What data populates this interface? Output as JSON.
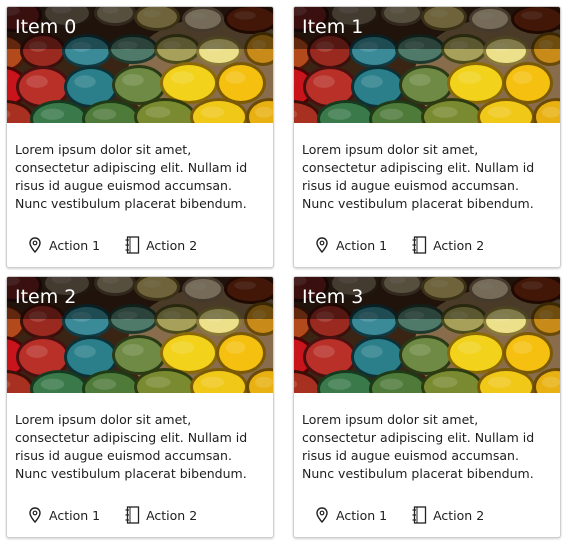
{
  "cards": [
    {
      "title": "Item 0",
      "body": "Lorem ipsum dolor sit amet, consectetur adipiscing elit. Nullam id risus id augue euismod accumsan. Nunc vestibulum placerat bibendum.",
      "actions": [
        {
          "label": "Action 1",
          "icon": "map-pin-icon"
        },
        {
          "label": "Action 2",
          "icon": "notebook-icon"
        }
      ]
    },
    {
      "title": "Item 1",
      "body": "Lorem ipsum dolor sit amet, consectetur adipiscing elit. Nullam id risus id augue euismod accumsan. Nunc vestibulum placerat bibendum.",
      "actions": [
        {
          "label": "Action 1",
          "icon": "map-pin-icon"
        },
        {
          "label": "Action 2",
          "icon": "notebook-icon"
        }
      ]
    },
    {
      "title": "Item 2",
      "body": "Lorem ipsum dolor sit amet, consectetur adipiscing elit. Nullam id risus id augue euismod accumsan. Nunc vestibulum placerat bibendum.",
      "actions": [
        {
          "label": "Action 1",
          "icon": "map-pin-icon"
        },
        {
          "label": "Action 2",
          "icon": "notebook-icon"
        }
      ]
    },
    {
      "title": "Item 3",
      "body": "Lorem ipsum dolor sit amet, consectetur adipiscing elit. Nullam id risus id augue euismod accumsan. Nunc vestibulum placerat bibendum.",
      "actions": [
        {
          "label": "Action 1",
          "icon": "map-pin-icon"
        },
        {
          "label": "Action 2",
          "icon": "notebook-icon"
        }
      ]
    }
  ]
}
